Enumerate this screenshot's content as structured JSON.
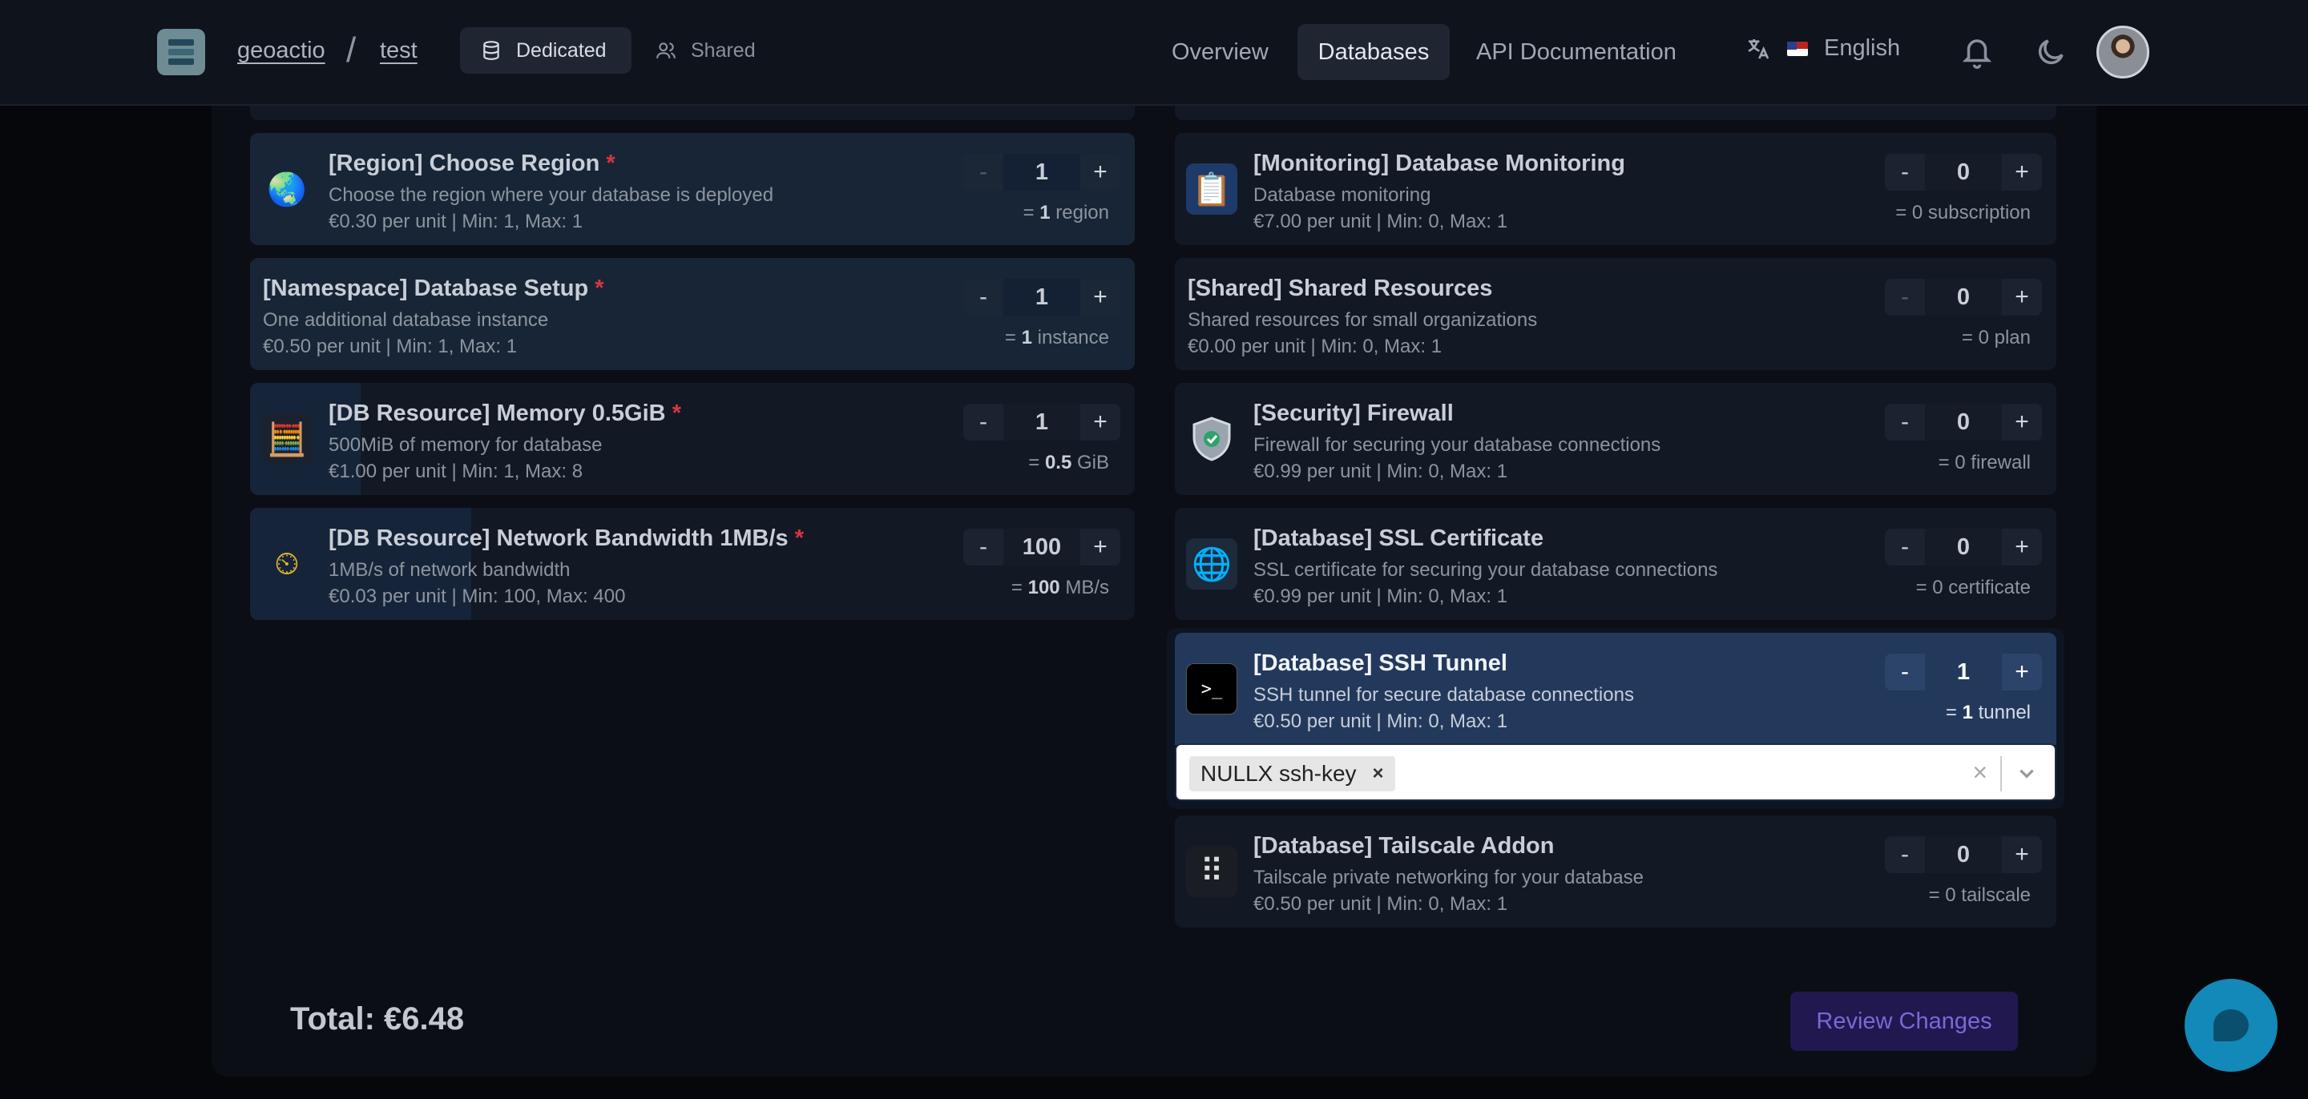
{
  "header": {
    "org": "geoactio",
    "separator": "/",
    "project": "test",
    "segments": {
      "dedicated": "Dedicated",
      "shared": "Shared"
    },
    "nav": {
      "overview": "Overview",
      "databases": "Databases",
      "api_docs": "API Documentation"
    },
    "language": "English",
    "icons": [
      "translate-icon",
      "us-flag-icon",
      "bell-icon",
      "moon-icon",
      "avatar"
    ]
  },
  "left_cards": [
    {
      "title": "[Region] Choose Region",
      "required": "*",
      "description": "Choose the region where your database is deployed",
      "price": "€0.30 per unit | Min: 1, Max: 1",
      "value": "1",
      "unit_prefix": "= ",
      "unit_value": "1",
      "unit_label": " region",
      "icon": "globe-icon",
      "icon_glyph": "🌏"
    },
    {
      "title": "[Namespace] Database Setup",
      "required": "*",
      "description": "One additional database instance",
      "price": "€0.50 per unit | Min: 1, Max: 1",
      "value": "1",
      "unit_prefix": "= ",
      "unit_value": "1",
      "unit_label": " instance"
    },
    {
      "title": "[DB Resource] Memory 0.5GiB",
      "required": "*",
      "description": "500MiB of memory for database",
      "price": "€1.00 per unit | Min: 1, Max: 8",
      "value": "1",
      "unit_prefix": "= ",
      "unit_value": "0.5",
      "unit_label": " GiB",
      "icon": "memory-chip-icon",
      "icon_glyph": "🧮",
      "fill_fraction": 0.125
    },
    {
      "title": "[DB Resource] Network Bandwidth 1MB/s",
      "required": "*",
      "description": "1MB/s of network bandwidth",
      "price": "€0.03 per unit | Min: 100, Max: 400",
      "value": "100",
      "unit_prefix": "= ",
      "unit_value": "100",
      "unit_label": " MB/s",
      "icon": "speedometer-icon",
      "icon_glyph": "⏲",
      "fill_fraction": 0.25
    }
  ],
  "right_cards": [
    {
      "title": "[Monitoring] Database Monitoring",
      "description": "Database monitoring",
      "price": "€7.00 per unit | Min: 0, Max: 1",
      "value": "0",
      "unit": "= 0 subscription",
      "icon": "monitoring-icon",
      "icon_glyph": "📋"
    },
    {
      "title": "[Shared] Shared Resources",
      "description": "Shared resources for small organizations",
      "price": "€0.00 per unit | Min: 0, Max: 1",
      "value": "0",
      "unit": "= 0 plan"
    },
    {
      "title": "[Security] Firewall",
      "description": "Firewall for securing your database connections",
      "price": "€0.99 per unit | Min: 0, Max: 1",
      "value": "0",
      "unit": "= 0 firewall",
      "icon": "shield-icon",
      "icon_glyph": "🛡"
    },
    {
      "title": "[Database] SSL Certificate",
      "description": "SSL certificate for securing your database connections",
      "price": "€0.99 per unit | Min: 0, Max: 1",
      "value": "0",
      "unit": "= 0 certificate",
      "icon": "certificate-globe-icon",
      "icon_glyph": "🌐"
    },
    {
      "title": "[Database] SSH Tunnel",
      "description": "SSH tunnel for secure database connections",
      "price": "€0.50 per unit | Min: 0, Max: 1",
      "value": "1",
      "unit_prefix": "= ",
      "unit_value": "1",
      "unit_label": " tunnel",
      "icon": "terminal-icon",
      "icon_glyph": ">_"
    },
    {
      "title": "[Database] Tailscale Addon",
      "description": "Tailscale private networking for your database",
      "price": "€0.50 per unit | Min: 0, Max: 1",
      "value": "0",
      "unit": "= 0 tailscale",
      "icon": "tailscale-icon",
      "icon_glyph": "⠿"
    }
  ],
  "ssh_key_select": {
    "tag": "NULLX ssh-key",
    "remove": "×",
    "clear": "×"
  },
  "stepper": {
    "minus": "-",
    "plus": "+"
  },
  "footer": {
    "total": "Total: €6.48",
    "review_button": "Review Changes"
  },
  "colors": {
    "accent": "#1f2632",
    "selected_card": "#23395c",
    "required": "#d9363e",
    "review_bg": "#20184e",
    "chat": "#1289b8"
  }
}
